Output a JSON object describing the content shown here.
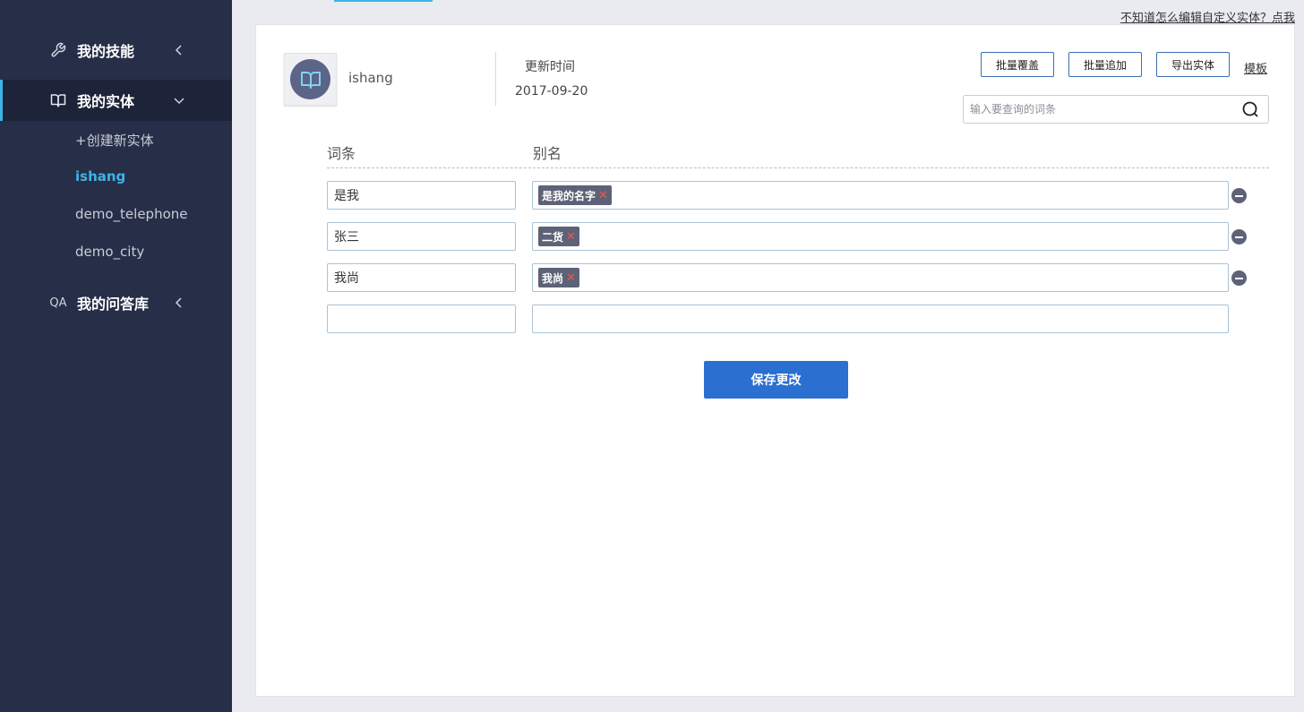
{
  "sidebar": {
    "skills": {
      "label": "我的技能",
      "icon": "wrench-icon"
    },
    "entities": {
      "label": "我的实体",
      "icon": "book-icon",
      "children": [
        "+创建新实体",
        "ishang",
        "demo_telephone",
        "demo_city"
      ],
      "current": "ishang"
    },
    "qa": {
      "label": "我的问答库",
      "icon_text": "QA"
    }
  },
  "help_link": "不知道怎么编辑自定义实体？点我",
  "entity": {
    "name": "ishang",
    "updated_label": "更新时间",
    "updated_date": "2017-09-20"
  },
  "toolbar": {
    "batch_overwrite": "批量覆盖",
    "batch_append": "批量追加",
    "export": "导出实体",
    "template": "模板"
  },
  "search": {
    "placeholder": "输入要查询的词条"
  },
  "table": {
    "headers": {
      "term": "词条",
      "alias": "别名"
    },
    "rows": [
      {
        "term": "是我",
        "aliases": [
          "是我的名字"
        ]
      },
      {
        "term": "张三",
        "aliases": [
          "二货"
        ]
      },
      {
        "term": "我尚",
        "aliases": [
          "我尚"
        ]
      },
      {
        "term": "",
        "aliases": []
      }
    ]
  },
  "save_label": "保存更改",
  "colors": {
    "sidebar_bg": "#272e48",
    "accent": "#3fb3e8",
    "primary": "#2b6fd1",
    "tag_bg": "#5d6277",
    "tag_close": "#f0564a"
  }
}
